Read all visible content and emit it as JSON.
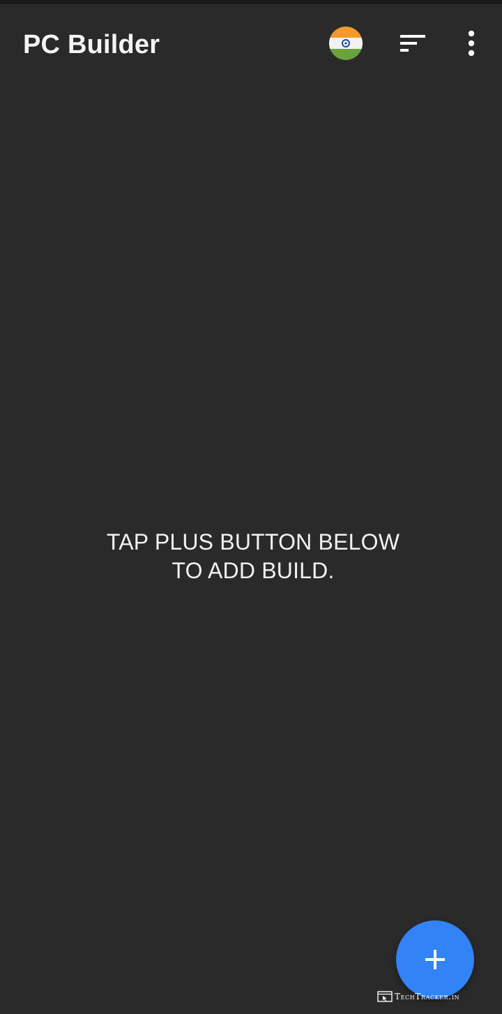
{
  "app_bar": {
    "title": "PC Builder",
    "region_icon": "india-flag-icon",
    "sort_icon": "sort-icon",
    "overflow_icon": "more-vert-icon"
  },
  "main": {
    "empty_message": {
      "line1": "TAP PLUS BUTTON BELOW",
      "line2": "TO ADD BUILD."
    }
  },
  "fab": {
    "icon": "plus-icon",
    "color": "#3183f6"
  },
  "watermark": {
    "text": "TechTracker.in"
  },
  "colors": {
    "background": "#2a2a2a",
    "text": "#f4f4f4",
    "accent": "#3183f6",
    "flag_saffron": "#f39a2b",
    "flag_white": "#f2f2f2",
    "flag_green": "#6aa33b",
    "flag_chakra": "#1d4f9c"
  }
}
